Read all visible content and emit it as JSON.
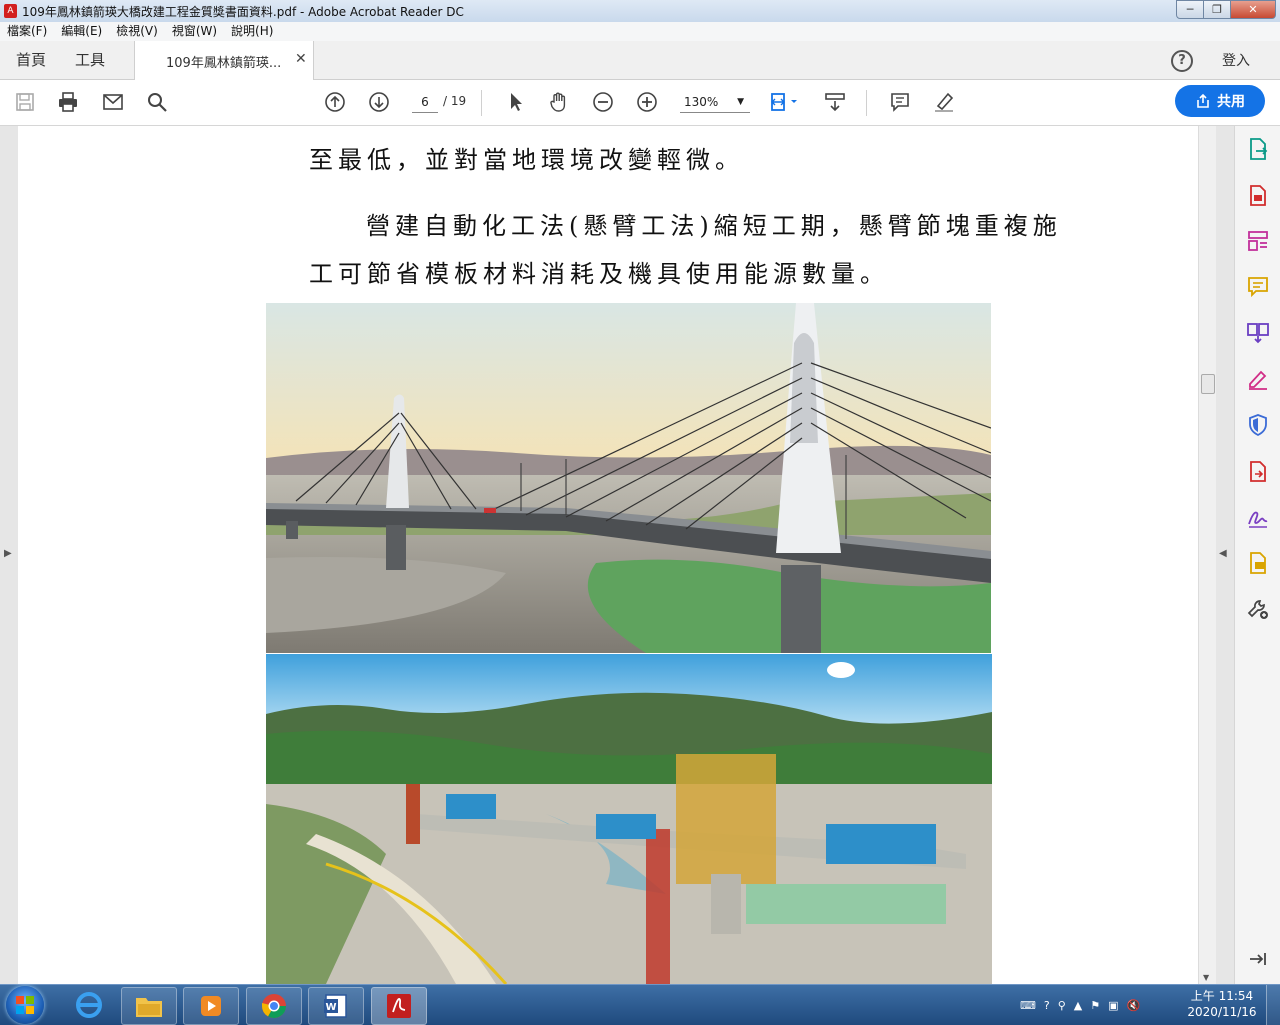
{
  "window": {
    "title": "109年鳳林鎮箭瑛大橋改建工程金質獎書面資料.pdf - Adobe Acrobat Reader DC",
    "controls": {
      "minimize": "─",
      "maximize": "❐",
      "close": "✕"
    }
  },
  "menu": [
    "檔案(F)",
    "編輯(E)",
    "檢視(V)",
    "視窗(W)",
    "說明(H)"
  ],
  "tabs": {
    "home": "首頁",
    "tools": "工具",
    "document": "109年鳳林鎮箭瑛...",
    "close": "✕"
  },
  "header": {
    "help": "?",
    "signin": "登入"
  },
  "toolbar": {
    "page_current": "6",
    "page_total": "/ 19",
    "zoom": "130%",
    "share_label": "共用"
  },
  "document": {
    "line1": "至最低，並對當地環境改變輕微。",
    "line2": "營建自動化工法(懸臂工法)縮短工期，懸臂節塊重複施",
    "line3": "工可節省模板材料消耗及機具使用能源數量。"
  },
  "taskbar": {
    "time": "上午 11:54",
    "date": "2020/11/16"
  },
  "colors": {
    "accent": "#1473e6",
    "acrobat_red": "#d21f1f",
    "taskbar": "#1f4a7e"
  }
}
